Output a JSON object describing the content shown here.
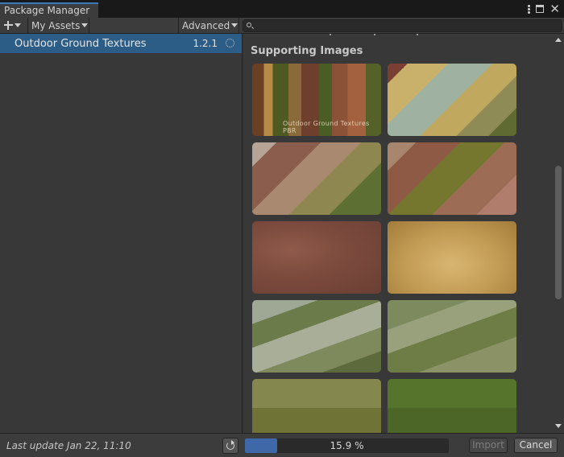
{
  "window": {
    "title": "Package Manager"
  },
  "toolbar": {
    "scope_dropdown": "My Assets",
    "advanced_dropdown": "Advanced",
    "search_value": ""
  },
  "package_list": {
    "items": [
      {
        "name": "Outdoor Ground Textures",
        "version": "1.2.1",
        "status": "loading"
      }
    ]
  },
  "details": {
    "section_title": "Supporting Images",
    "images": [
      {
        "caption": "Outdoor Ground Textures PBR"
      },
      {
        "caption": ""
      },
      {
        "caption": ""
      },
      {
        "caption": ""
      },
      {
        "caption": ""
      },
      {
        "caption": ""
      },
      {
        "caption": ""
      },
      {
        "caption": ""
      },
      {
        "caption": ""
      },
      {
        "caption": ""
      }
    ]
  },
  "status_bar": {
    "last_update": "Last update Jan 22, 11:10",
    "progress_text": "15.9 %",
    "progress_value": 15.9,
    "import_label": "Import",
    "cancel_label": "Cancel"
  },
  "colors": {
    "selection": "#2c5d87",
    "progress_fill": "#3e68a8",
    "tab_accent": "#3a79bb"
  }
}
